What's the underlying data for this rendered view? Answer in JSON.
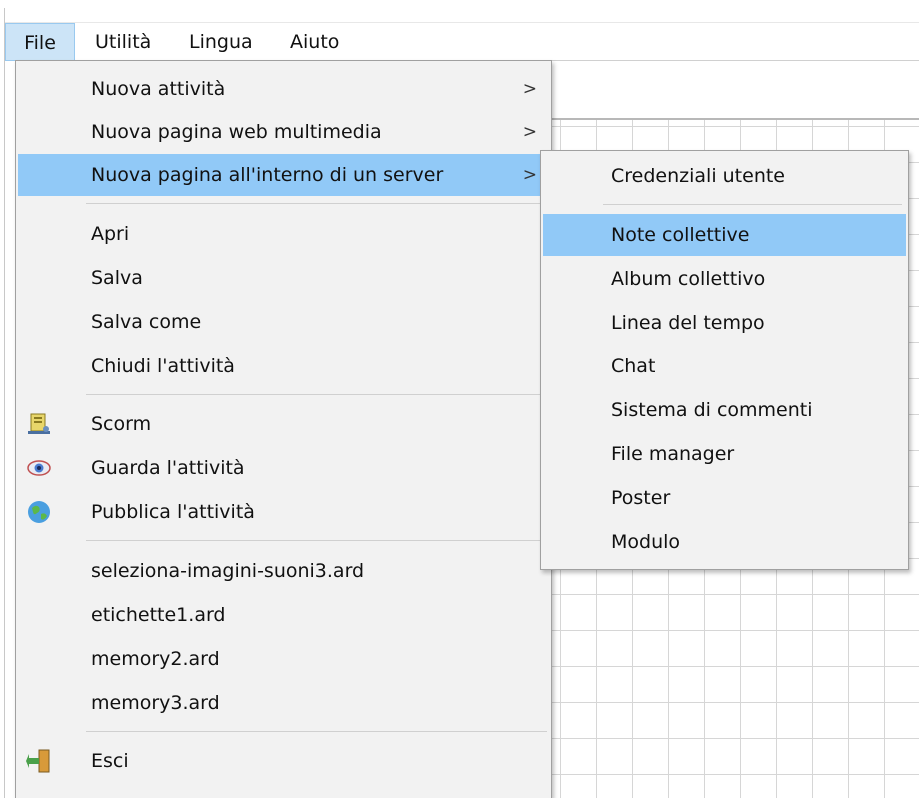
{
  "menubar": {
    "items": [
      {
        "label": "File",
        "active": true
      },
      {
        "label": "Utilità"
      },
      {
        "label": "Lingua"
      },
      {
        "label": "Aiuto"
      }
    ]
  },
  "file_menu": {
    "new_activity": "Nuova attività",
    "new_web_page": "Nuova pagina web multimedia",
    "new_server_page": "Nuova pagina all'interno di un server",
    "open": "Apri",
    "save": "Salva",
    "save_as": "Salva come",
    "close_activity": "Chiudi l'attività",
    "scorm": "Scorm",
    "view_activity": "Guarda l'attività",
    "publish_activity": "Pubblica l'attività",
    "recent_files": [
      "seleziona-imagini-suoni3.ard",
      "etichette1.ard",
      "memory2.ard",
      "memory3.ard"
    ],
    "exit": "Esci",
    "submenu_arrow": ">"
  },
  "server_submenu": {
    "items": [
      "Credenziali utente",
      "Note collettive",
      "Album collettivo",
      "Linea del tempo",
      "Chat",
      "Sistema di commenti",
      "File manager",
      "Poster",
      "Modulo"
    ],
    "highlighted": "Note collettive"
  },
  "colors": {
    "menu_bg": "#f2f2f2",
    "highlight": "#91c9f7",
    "menubar_active": "#cce4f7"
  },
  "icons": {
    "scorm": "scorm-package-icon",
    "view": "eye-icon",
    "publish": "globe-icon",
    "exit": "exit-door-icon"
  }
}
